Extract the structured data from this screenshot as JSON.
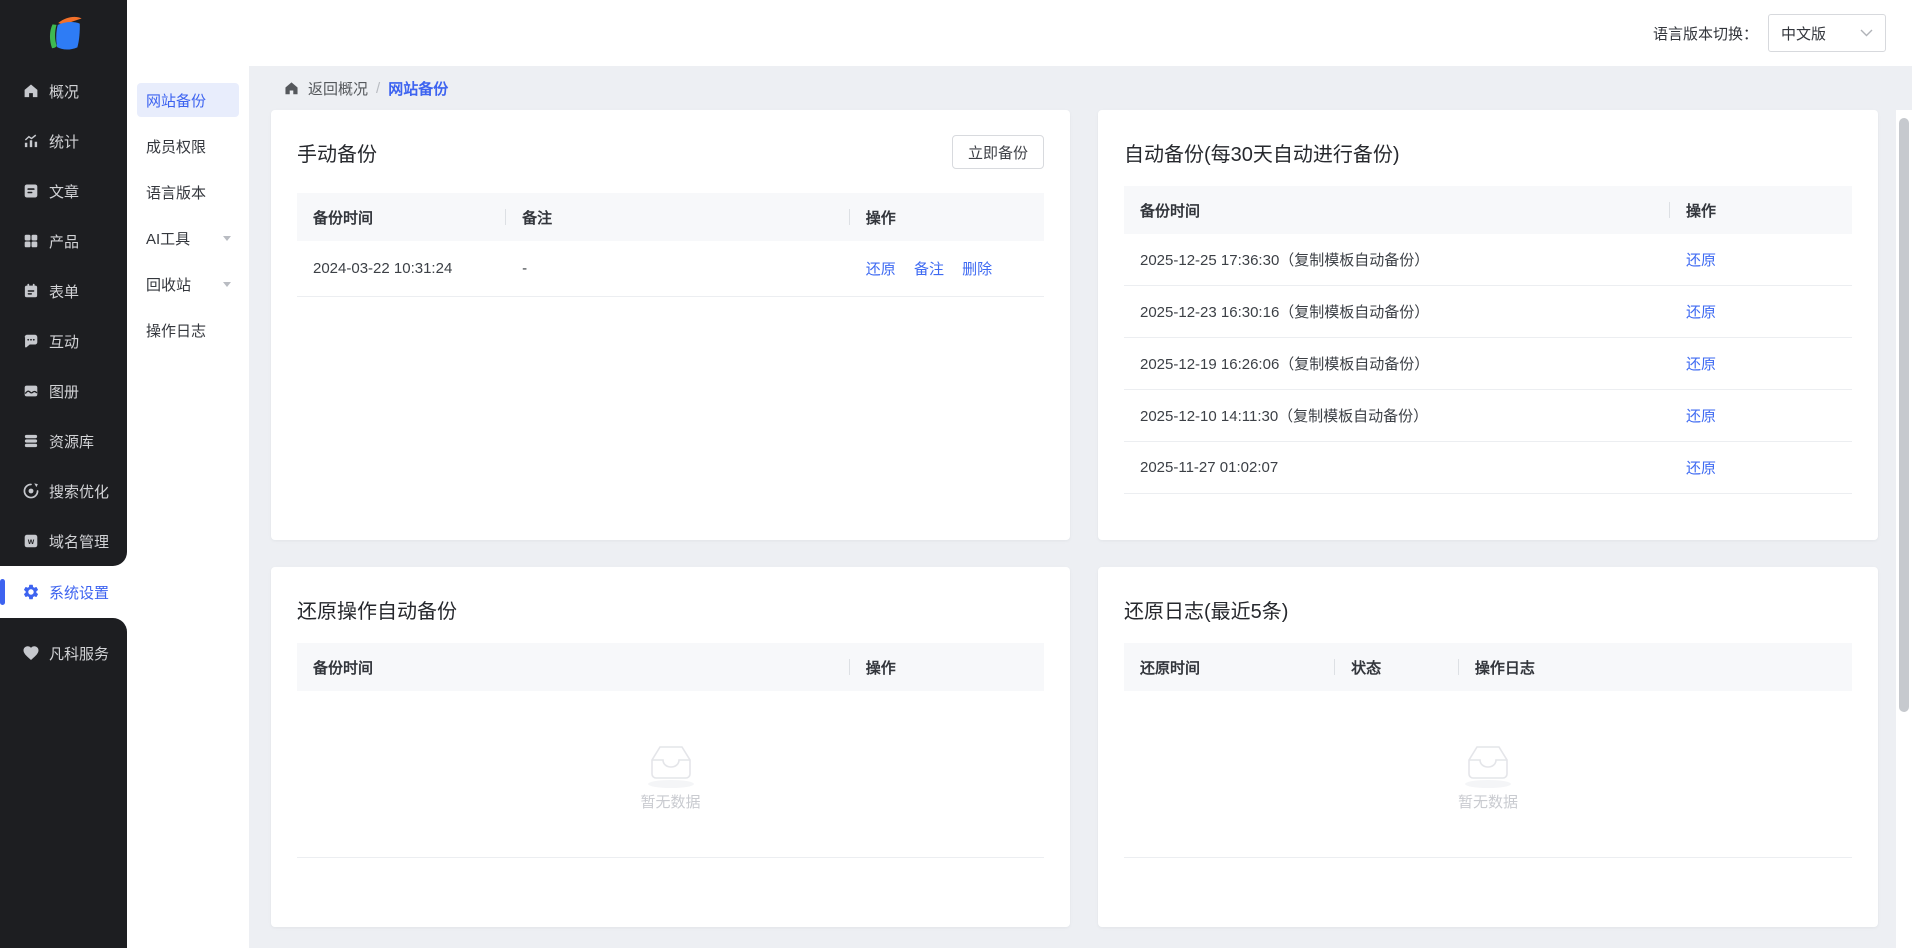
{
  "colors": {
    "accent_blue": "#3d63f0",
    "link_blue": "#3e6af2",
    "sidebar_bg": "#1d1e21",
    "page_bg": "#edeff3",
    "active_item_bg": "#e8edfc",
    "table_header_bg": "#f7f8fa"
  },
  "topbar": {
    "language_label": "语言版本切换：",
    "language_value": "中文版"
  },
  "sidebar": {
    "items": [
      {
        "label": "概况",
        "icon": "home-icon"
      },
      {
        "label": "统计",
        "icon": "stats-icon"
      },
      {
        "label": "文章",
        "icon": "article-icon"
      },
      {
        "label": "产品",
        "icon": "products-icon"
      },
      {
        "label": "表单",
        "icon": "form-icon"
      },
      {
        "label": "互动",
        "icon": "chat-icon"
      },
      {
        "label": "图册",
        "icon": "gallery-icon"
      },
      {
        "label": "资源库",
        "icon": "database-icon"
      },
      {
        "label": "搜索优化",
        "icon": "seo-icon"
      },
      {
        "label": "域名管理",
        "icon": "domain-icon"
      }
    ],
    "selected": {
      "label": "系统设置",
      "icon": "gear-icon"
    },
    "bottom": {
      "label": "凡科服务",
      "icon": "heart-icon"
    }
  },
  "subsidebar": {
    "items": [
      {
        "label": "网站备份",
        "active": true
      },
      {
        "label": "成员权限"
      },
      {
        "label": "语言版本"
      },
      {
        "label": "AI工具",
        "expandable": true
      },
      {
        "label": "回收站",
        "expandable": true
      },
      {
        "label": "操作日志"
      }
    ]
  },
  "breadcrumb": {
    "back": "返回概况",
    "separator": "/",
    "current": "网站备份"
  },
  "panels": {
    "manual": {
      "title": "手动备份",
      "button_label": "立即备份",
      "columns": [
        "备份时间",
        "备注",
        "操作"
      ],
      "rows": [
        {
          "time": "2024-03-22 10:31:24",
          "note": "-",
          "actions": [
            "还原",
            "备注",
            "删除"
          ]
        }
      ]
    },
    "auto": {
      "title": "自动备份(每30天自动进行备份)",
      "columns": [
        "备份时间",
        "操作"
      ],
      "rows": [
        {
          "time": "2025-12-25 17:36:30（复制模板自动备份）",
          "action": "还原"
        },
        {
          "time": "2025-12-23 16:30:16（复制模板自动备份）",
          "action": "还原"
        },
        {
          "time": "2025-12-19 16:26:06（复制模板自动备份）",
          "action": "还原"
        },
        {
          "time": "2025-12-10 14:11:30（复制模板自动备份）",
          "action": "还原"
        },
        {
          "time": "2025-11-27 01:02:07",
          "action": "还原"
        }
      ]
    },
    "restore_backup": {
      "title": "还原操作自动备份",
      "columns": [
        "备份时间",
        "操作"
      ],
      "empty_text": "暂无数据"
    },
    "restore_log": {
      "title": "还原日志(最近5条)",
      "columns": [
        "还原时间",
        "状态",
        "操作日志"
      ],
      "empty_text": "暂无数据"
    }
  }
}
